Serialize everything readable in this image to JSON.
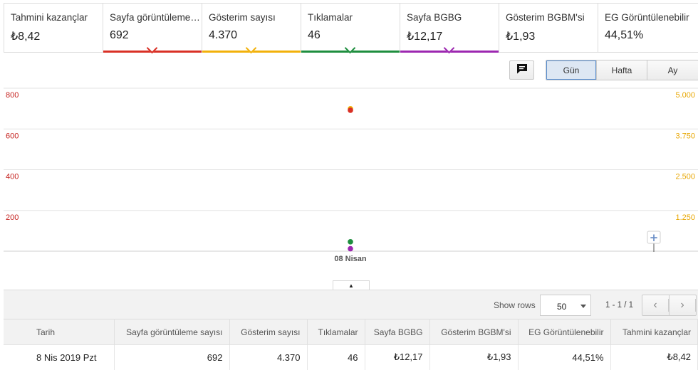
{
  "metrics": [
    {
      "label": "Tahmini kazançlar",
      "value": "₺8,42",
      "color": ""
    },
    {
      "label": "Sayfa görüntüleme sayısı",
      "value": "692",
      "color": "#d93025"
    },
    {
      "label": "Gösterim sayısı",
      "value": "4.370",
      "color": "#f2b10a"
    },
    {
      "label": "Tıklamalar",
      "value": "46",
      "color": "#1e8e3e"
    },
    {
      "label": "Sayfa BGBG",
      "value": "₺12,17",
      "color": "#9c27b0"
    },
    {
      "label": "Gösterim BGBM'si",
      "value": "₺1,93",
      "color": ""
    },
    {
      "label": "EG Görüntülenebilir",
      "value": "44,51%",
      "color": ""
    }
  ],
  "toolbar": {
    "chat_icon": "comment-icon",
    "range_buttons": [
      "Gün",
      "Hafta",
      "Ay"
    ],
    "active_range": "Gün"
  },
  "chart_data": {
    "type": "scatter",
    "x_categories": [
      "08 Nisan"
    ],
    "left_axis": {
      "ticks": [
        "800",
        "600",
        "400",
        "200"
      ],
      "ylim": [
        0,
        800
      ],
      "color": "#c5221f"
    },
    "right_axis": {
      "ticks": [
        "5.000",
        "3.750",
        "2.500",
        "1.250"
      ],
      "ylim": [
        0,
        5000
      ],
      "color": "#e8a600"
    },
    "series": [
      {
        "metric": "Gösterim sayısı",
        "x": "08 Nisan",
        "y": 4370,
        "axis": "right",
        "color": "#f2b10a"
      },
      {
        "metric": "Sayfa görüntüleme sayısı",
        "x": "08 Nisan",
        "y": 692,
        "axis": "left",
        "color": "#d93025"
      },
      {
        "metric": "Tıklamalar",
        "x": "08 Nisan",
        "y": 46,
        "axis": "left",
        "color": "#1e8e3e"
      },
      {
        "metric": "Sayfa BGBG",
        "x": "08 Nisan",
        "y": 12.17,
        "axis": "left",
        "color": "#9c27b0"
      }
    ],
    "grid": true,
    "annotation_icon": "plus-icon"
  },
  "table": {
    "show_rows_label": "Show rows",
    "rows_per_page": "50",
    "range_text": "1 - 1 / 1",
    "columns": [
      "Tarih",
      "Sayfa görüntüleme sayısı",
      "Gösterim sayısı",
      "Tıklamalar",
      "Sayfa BGBG",
      "Gösterim BGBM'si",
      "EG Görüntülenebilir",
      "Tahmini kazançlar"
    ],
    "rows": [
      [
        "8 Nis 2019 Pzt",
        "692",
        "4.370",
        "46",
        "₺12,17",
        "₺1,93",
        "44,51%",
        "₺8,42"
      ]
    ]
  }
}
